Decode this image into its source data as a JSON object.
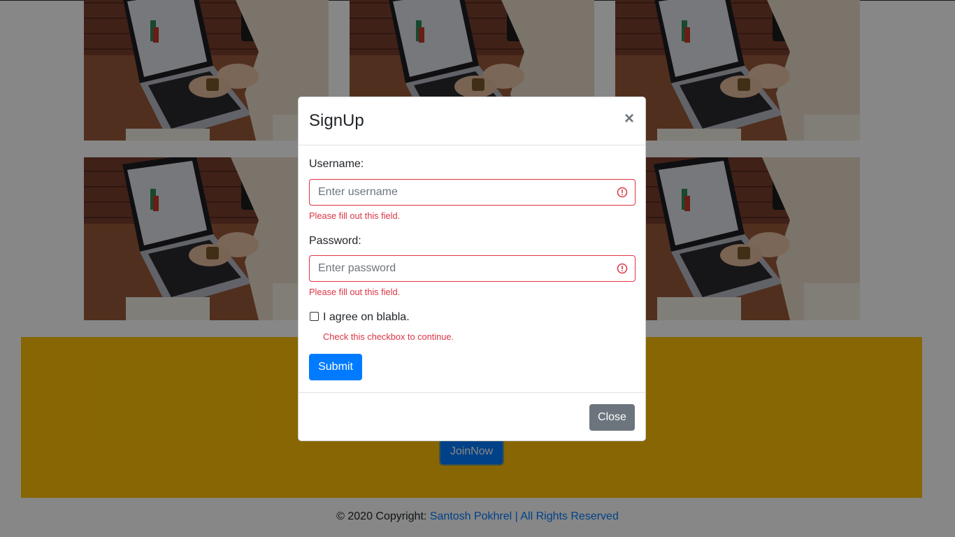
{
  "gallery": {
    "image_alt": "person typing on laptop"
  },
  "banner": {
    "join_label": "JoinNow"
  },
  "footer": {
    "copyright_prefix": "© 2020 Copyright: ",
    "link_text": "Santosh Pokhrel | All Rights Reserved"
  },
  "modal": {
    "title": "SignUp",
    "close_symbol": "×",
    "username": {
      "label": "Username:",
      "placeholder": "Enter username",
      "error": "Please fill out this field."
    },
    "password": {
      "label": "Password:",
      "placeholder": "Enter password",
      "error": "Please fill out this field."
    },
    "agree": {
      "label": "I agree on blabla.",
      "error": "Check this checkbox to continue."
    },
    "submit_label": "Submit",
    "close_label": "Close"
  },
  "colors": {
    "primary": "#007bff",
    "danger": "#dc3545",
    "secondary": "#6c757d",
    "banner": "#ffc107"
  }
}
